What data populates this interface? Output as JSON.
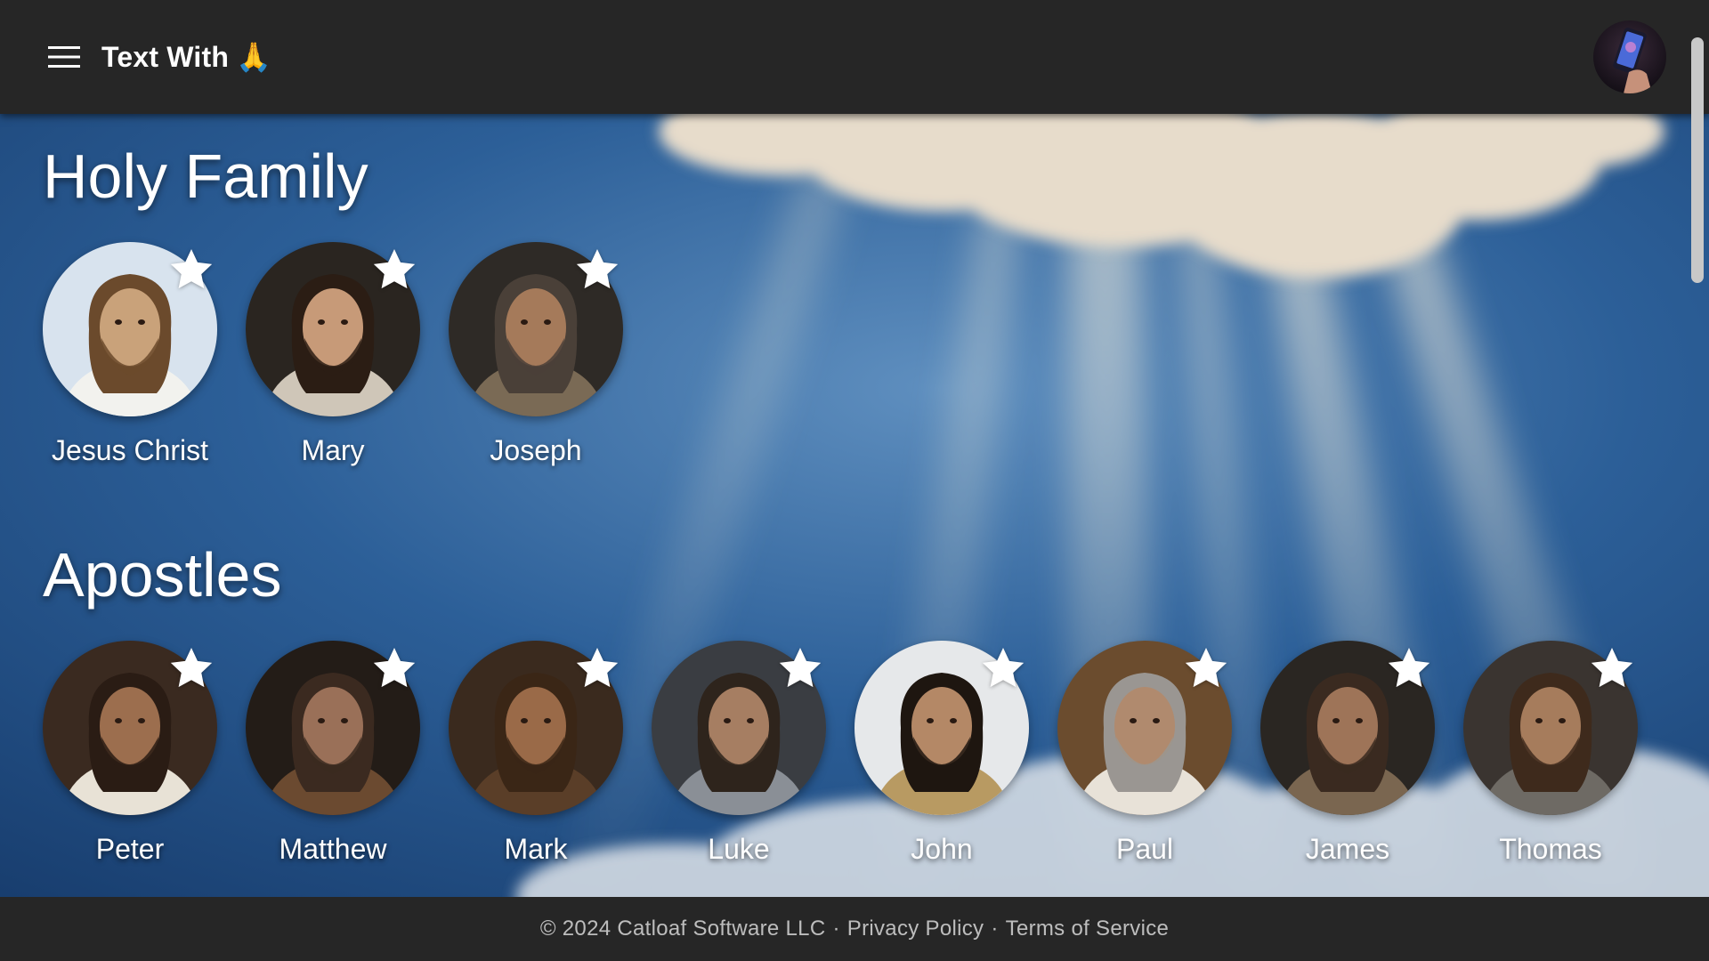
{
  "header": {
    "title": "Text With",
    "title_emoji": "🙏",
    "menu_icon": "hamburger-menu-icon",
    "avatar_icon": "phone-avatar"
  },
  "sections": [
    {
      "title": "Holy Family",
      "people": [
        {
          "name": "Jesus Christ",
          "tone": "#c9a27a",
          "bg": "#d8e3ee",
          "hair": "#6b4a2c",
          "robe": "#f2f2ee"
        },
        {
          "name": "Mary",
          "tone": "#c79a78",
          "bg": "#2a2520",
          "hair": "#2b1d14",
          "robe": "#cfc6b8"
        },
        {
          "name": "Joseph",
          "tone": "#a57a5a",
          "bg": "#2e2a26",
          "hair": "#4a4038",
          "robe": "#7a6a55"
        }
      ]
    },
    {
      "title": "Apostles",
      "people": [
        {
          "name": "Peter",
          "tone": "#9c6e4e",
          "bg": "#3a2a20",
          "hair": "#2a1c14",
          "robe": "#e8e2d6"
        },
        {
          "name": "Matthew",
          "tone": "#9a7058",
          "bg": "#231c17",
          "hair": "#3b2a20",
          "robe": "#6b4a30"
        },
        {
          "name": "Mark",
          "tone": "#9a6a48",
          "bg": "#3a2a1e",
          "hair": "#3a2616",
          "robe": "#5a3e28"
        },
        {
          "name": "Luke",
          "tone": "#a67e62",
          "bg": "#3a3d42",
          "hair": "#2e241c",
          "robe": "#8a8f96"
        },
        {
          "name": "John",
          "tone": "#b48866",
          "bg": "#e6e8ea",
          "hair": "#1e1610",
          "robe": "#b89a62"
        },
        {
          "name": "Paul",
          "tone": "#b08a6e",
          "bg": "#6b4c2e",
          "hair": "#9a9692",
          "robe": "#e8e2d8"
        },
        {
          "name": "James",
          "tone": "#9e7458",
          "bg": "#2a2622",
          "hair": "#3a2a20",
          "robe": "#7a6650"
        },
        {
          "name": "Thomas",
          "tone": "#a67c5c",
          "bg": "#3a3430",
          "hair": "#3e2a1c",
          "robe": "#6e6a64"
        }
      ]
    }
  ],
  "footer": {
    "copyright": "© 2024 Catloaf Software LLC",
    "separator": "·",
    "privacy": "Privacy Policy",
    "terms": "Terms of Service"
  },
  "colors": {
    "header_bg": "#262626",
    "sky_blue": "#1f4f86",
    "star": "#ffffff"
  }
}
